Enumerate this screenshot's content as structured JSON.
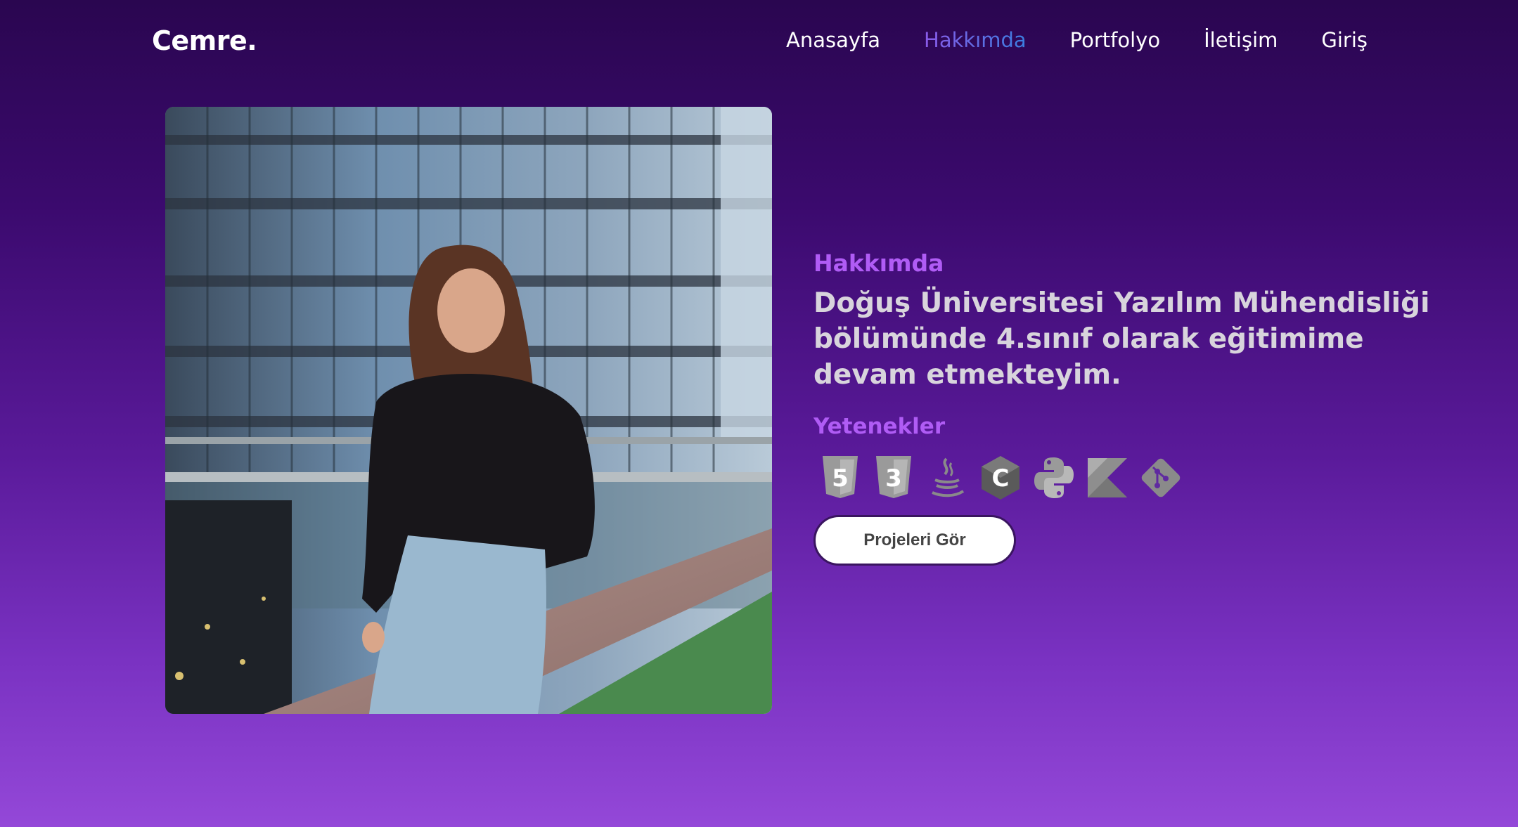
{
  "brand": {
    "logo": "Cemre."
  },
  "nav": {
    "items": [
      {
        "label": "Anasayfa",
        "active": false
      },
      {
        "label": "Hakkımda",
        "active": true
      },
      {
        "label": "Portfolyo",
        "active": false
      },
      {
        "label": "İletişim",
        "active": false
      },
      {
        "label": "Giriş",
        "active": false
      }
    ]
  },
  "about": {
    "section_label": "Hakkımda",
    "headline": "Doğuş Üniversitesi Yazılım Mühendisliği bölümünde 4.sınıf olarak eğitimime devam etmekteyim.",
    "skills_label": "Yetenekler",
    "skills": [
      {
        "name": "HTML5",
        "icon": "html5-icon",
        "glyph": "5"
      },
      {
        "name": "CSS3",
        "icon": "css3-icon",
        "glyph": "3"
      },
      {
        "name": "Java",
        "icon": "java-icon"
      },
      {
        "name": "C",
        "icon": "c-icon",
        "glyph": "C"
      },
      {
        "name": "Python",
        "icon": "python-icon"
      },
      {
        "name": "Kotlin",
        "icon": "kotlin-icon"
      },
      {
        "name": "Git",
        "icon": "git-icon"
      }
    ],
    "cta_label": "Projeleri Gör"
  },
  "colors": {
    "accent": "#b05cf5",
    "nav_active_start": "#8a5ae8",
    "nav_active_end": "#3a7fe0",
    "headline": "#d8d4dc",
    "icon_gray": "#8a8a8a"
  }
}
